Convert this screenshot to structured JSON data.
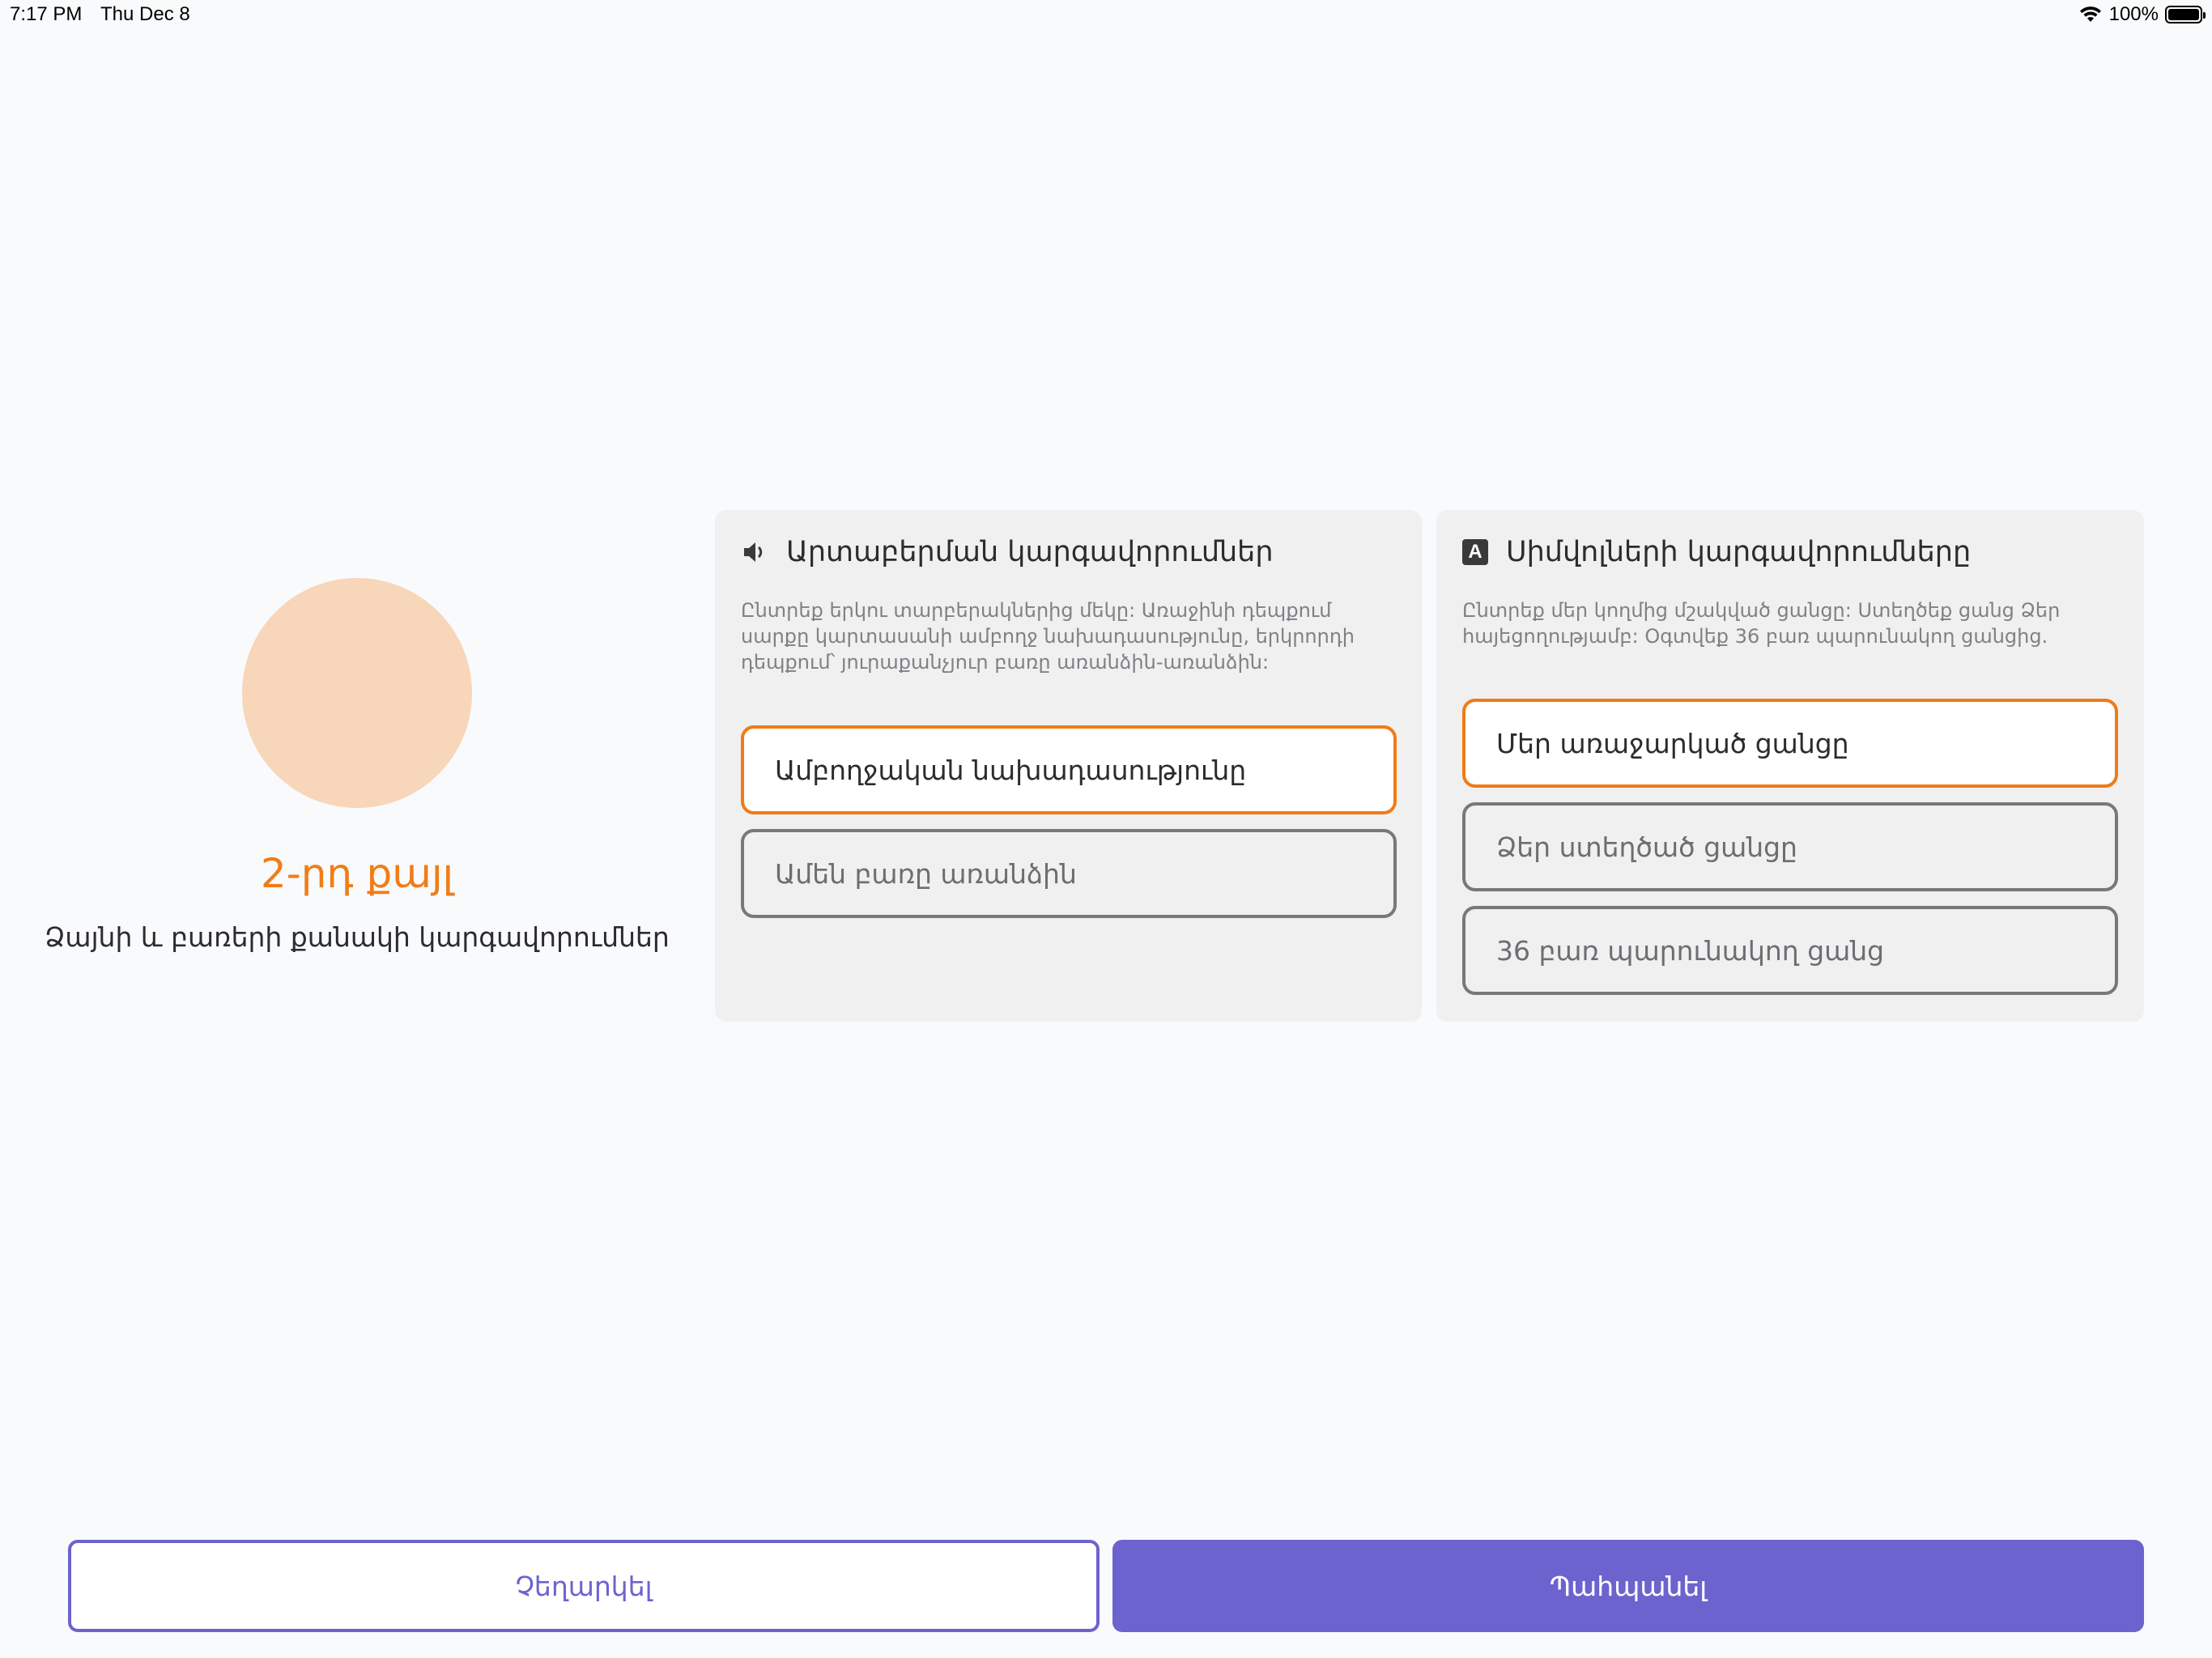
{
  "status_bar": {
    "time": "7:17 PM",
    "date": "Thu Dec 8",
    "battery": "100%"
  },
  "step": {
    "title": "2-րդ քայլ",
    "subtitle": "Ձայնի և բառերի քանակի կարգավորումներ"
  },
  "pronunciation": {
    "icon": "speaker-icon",
    "title": "Արտաբերման կարգավորումներ",
    "description": "Ընտրեք երկու տարբերակներից մեկը: Առաջինի դեպքում սարքը կարտասանի ամբողջ նախադասությունը, երկրորդի դեպքում՝ յուրաքանչյուր բառը առանձին-առանձին:",
    "options": [
      {
        "label": "Ամբողջական նախադասությունը",
        "selected": true
      },
      {
        "label": "Ամեն բառը առանձին",
        "selected": false
      }
    ]
  },
  "symbols": {
    "icon": "letter-a-icon",
    "title": "Սիմվոլների կարգավորումները",
    "description": "Ընտրեք մեր կողմից մշակված ցանցը: Ստեղծեք ցանց Ձեր հայեցողությամբ: Օգտվեք 36 բառ պարունակող ցանցից.",
    "options": [
      {
        "label": "Մեր առաջարկած ցանցը",
        "selected": true
      },
      {
        "label": "Ձեր ստեղծած ցանցը",
        "selected": false
      },
      {
        "label": "36 բառ պարունակող ցանց",
        "selected": false
      }
    ]
  },
  "buttons": {
    "cancel": "Չեղարկել",
    "save": "Պահպանել"
  },
  "colors": {
    "accent": "#6c63cf",
    "highlight": "#f07b17",
    "step_circle": "#f8d6b9"
  }
}
